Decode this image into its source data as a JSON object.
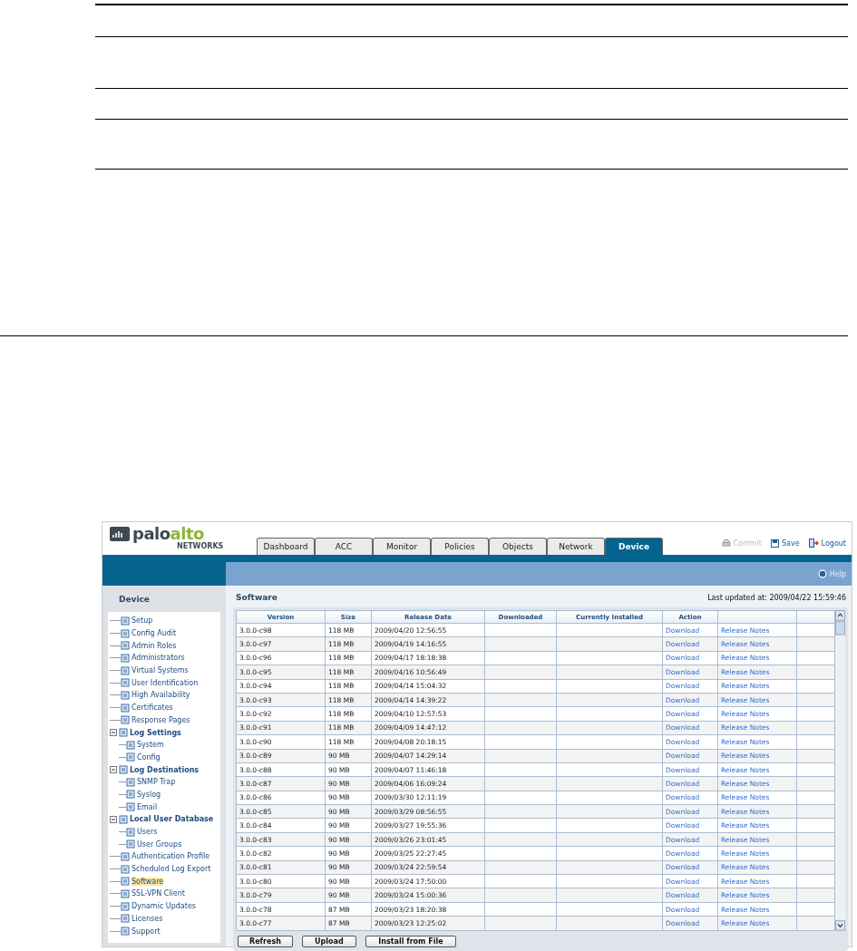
{
  "logo": {
    "wordmark": [
      "palo",
      "alto"
    ],
    "tagline": "NETWORKS"
  },
  "tabs": [
    {
      "label": "Dashboard",
      "selected": false
    },
    {
      "label": "ACC",
      "selected": false
    },
    {
      "label": "Monitor",
      "selected": false
    },
    {
      "label": "Policies",
      "selected": false
    },
    {
      "label": "Objects",
      "selected": false
    },
    {
      "label": "Network",
      "selected": false
    },
    {
      "label": "Device",
      "selected": true
    }
  ],
  "header_actions": [
    {
      "kind": "commit",
      "label": "Commit",
      "disabled": true
    },
    {
      "kind": "save",
      "label": "Save",
      "disabled": false
    },
    {
      "kind": "logout",
      "label": "Logout",
      "disabled": false
    }
  ],
  "help": "Help",
  "sidebar": {
    "title": "Device",
    "items": [
      {
        "label": "Setup",
        "selected": false
      },
      {
        "label": "Config Audit",
        "selected": false
      },
      {
        "label": "Admin Roles",
        "selected": false
      },
      {
        "label": "Administrators",
        "selected": false
      },
      {
        "label": "Virtual Systems",
        "selected": false
      },
      {
        "label": "User Identification",
        "selected": false
      },
      {
        "label": "High Availability",
        "selected": false
      },
      {
        "label": "Certificates",
        "selected": false
      },
      {
        "label": "Response Pages",
        "selected": false
      },
      {
        "label": "Log Settings",
        "selected": false,
        "expanded": true,
        "children": [
          {
            "label": "System",
            "selected": false
          },
          {
            "label": "Config",
            "selected": false
          }
        ]
      },
      {
        "label": "Log Destinations",
        "selected": false,
        "expanded": true,
        "children": [
          {
            "label": "SNMP Trap",
            "selected": false
          },
          {
            "label": "Syslog",
            "selected": false
          },
          {
            "label": "Email",
            "selected": false
          }
        ]
      },
      {
        "label": "Local User Database",
        "selected": false,
        "expanded": true,
        "children": [
          {
            "label": "Users",
            "selected": false
          },
          {
            "label": "User Groups",
            "selected": false
          }
        ]
      },
      {
        "label": "Authentication Profile",
        "selected": false
      },
      {
        "label": "Scheduled Log Export",
        "selected": false
      },
      {
        "label": "Software",
        "selected": true
      },
      {
        "label": "SSL-VPN Client",
        "selected": false
      },
      {
        "label": "Dynamic Updates",
        "selected": false
      },
      {
        "label": "Licenses",
        "selected": false
      },
      {
        "label": "Support",
        "selected": false
      }
    ]
  },
  "content": {
    "title": "Software",
    "last_updated": "Last updated at: 2009/04/22 15:59:46"
  },
  "table": {
    "columns": [
      "Version",
      "Size",
      "Release Date",
      "Downloaded",
      "Currently Installed",
      "Action"
    ],
    "rows": [
      {
        "version": "3.0.0-c98",
        "size": "118 MB",
        "release_date": "2009/04/20 12:56:55",
        "action": "Download",
        "notes": "Release Notes"
      },
      {
        "version": "3.0.0-c97",
        "size": "118 MB",
        "release_date": "2009/04/19 14:16:55",
        "action": "Download",
        "notes": "Release Notes"
      },
      {
        "version": "3.0.0-c96",
        "size": "118 MB",
        "release_date": "2009/04/17 18:18:38",
        "action": "Download",
        "notes": "Release Notes"
      },
      {
        "version": "3.0.0-c95",
        "size": "118 MB",
        "release_date": "2009/04/16 10:56:49",
        "action": "Download",
        "notes": "Release Notes"
      },
      {
        "version": "3.0.0-c94",
        "size": "118 MB",
        "release_date": "2009/04/14 15:04:32",
        "action": "Download",
        "notes": "Release Notes"
      },
      {
        "version": "3.0.0-c93",
        "size": "118 MB",
        "release_date": "2009/04/14 14:39:22",
        "action": "Download",
        "notes": "Release Notes"
      },
      {
        "version": "3.0.0-c92",
        "size": "118 MB",
        "release_date": "2009/04/10 12:57:53",
        "action": "Download",
        "notes": "Release Notes"
      },
      {
        "version": "3.0.0-c91",
        "size": "118 MB",
        "release_date": "2009/04/09 14:47:12",
        "action": "Download",
        "notes": "Release Notes"
      },
      {
        "version": "3.0.0-c90",
        "size": "118 MB",
        "release_date": "2009/04/08 20:18:15",
        "action": "Download",
        "notes": "Release Notes"
      },
      {
        "version": "3.0.0-c89",
        "size": "90 MB",
        "release_date": "2009/04/07 14:29:14",
        "action": "Download",
        "notes": "Release Notes"
      },
      {
        "version": "3.0.0-c88",
        "size": "90 MB",
        "release_date": "2009/04/07 11:46:18",
        "action": "Download",
        "notes": "Release Notes"
      },
      {
        "version": "3.0.0-c87",
        "size": "90 MB",
        "release_date": "2009/04/06 16:09:24",
        "action": "Download",
        "notes": "Release Notes"
      },
      {
        "version": "3.0.0-c86",
        "size": "90 MB",
        "release_date": "2009/03/30 12:11:19",
        "action": "Download",
        "notes": "Release Notes"
      },
      {
        "version": "3.0.0-c85",
        "size": "90 MB",
        "release_date": "2009/03/29 08:56:55",
        "action": "Download",
        "notes": "Release Notes"
      },
      {
        "version": "3.0.0-c84",
        "size": "90 MB",
        "release_date": "2009/03/27 19:55:36",
        "action": "Download",
        "notes": "Release Notes"
      },
      {
        "version": "3.0.0-c83",
        "size": "90 MB",
        "release_date": "2009/03/26 23:01:45",
        "action": "Download",
        "notes": "Release Notes"
      },
      {
        "version": "3.0.0-c82",
        "size": "90 MB",
        "release_date": "2009/03/25 22:27:45",
        "action": "Download",
        "notes": "Release Notes"
      },
      {
        "version": "3.0.0-c81",
        "size": "90 MB",
        "release_date": "2009/03/24 22:59:54",
        "action": "Download",
        "notes": "Release Notes"
      },
      {
        "version": "3.0.0-c80",
        "size": "90 MB",
        "release_date": "2009/03/24 17:50:00",
        "action": "Download",
        "notes": "Release Notes"
      },
      {
        "version": "3.0.0-c79",
        "size": "90 MB",
        "release_date": "2009/03/24 15:00:36",
        "action": "Download",
        "notes": "Release Notes"
      },
      {
        "version": "3.0.0-c78",
        "size": "87 MB",
        "release_date": "2009/03/23 18:20:38",
        "action": "Download",
        "notes": "Release Notes"
      },
      {
        "version": "3.0.0-c77",
        "size": "87 MB",
        "release_date": "2009/03/23 12:25:02",
        "action": "Download",
        "notes": "Release Notes"
      }
    ]
  },
  "buttons": [
    "Refresh",
    "Upload",
    "Install from File"
  ]
}
